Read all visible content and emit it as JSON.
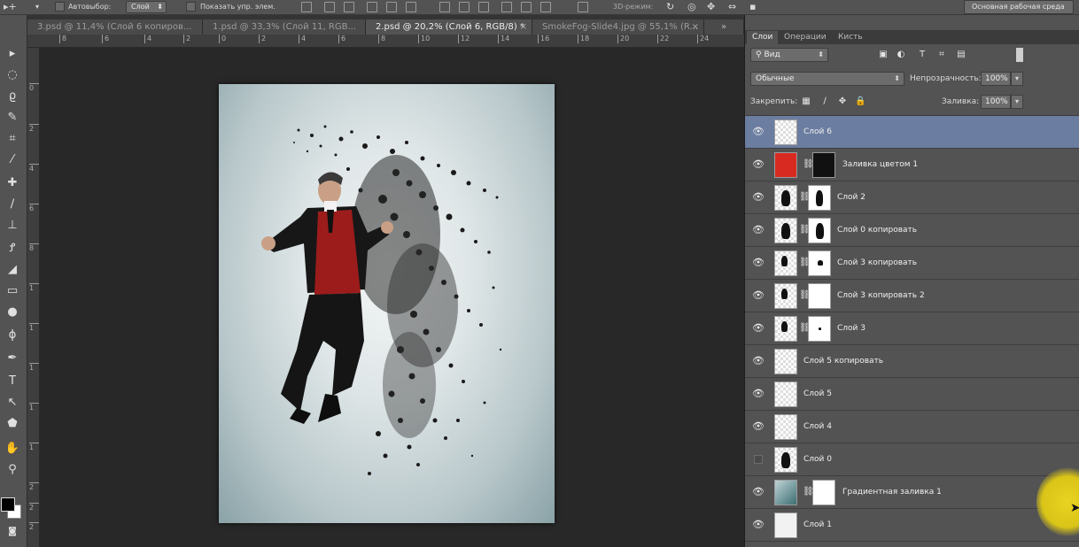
{
  "option_bar": {
    "auto_select_label": "Автовыбор:",
    "auto_select_value": "Слой",
    "show_transform_label": "Показать упр. элем.",
    "mode_3d_label": "3D-режим:",
    "workspace_label": "Основная рабочая среда"
  },
  "tabs": [
    {
      "label": "3.psd @ 11,4% (Слой 6 копиров...",
      "active": false
    },
    {
      "label": "1.psd @ 33,3% (Слой 11, RGB...",
      "active": false
    },
    {
      "label": "2.psd @ 20,2% (Слой 6, RGB/8) *",
      "active": true
    },
    {
      "label": "SmokeFog-Slide4.jpg @ 55,1% (R...",
      "active": false
    }
  ],
  "ruler_top": [
    "8",
    "6",
    "4",
    "2",
    "0",
    "2",
    "4",
    "6",
    "8",
    "10",
    "12",
    "14",
    "16",
    "18",
    "20",
    "22",
    "24"
  ],
  "ruler_left": [
    "0",
    "2",
    "4",
    "6",
    "8",
    "1",
    "1",
    "1",
    "1",
    "1",
    "2",
    "2",
    "2"
  ],
  "panel": {
    "tabs": [
      "Слои",
      "Операции",
      "Кисть"
    ],
    "filter_label": "Вид",
    "blend_mode": "Обычные",
    "opacity_label": "Непрозрачность:",
    "opacity_value": "100%",
    "lock_label": "Закрепить:",
    "fill_label": "Заливка:",
    "fill_value": "100%"
  },
  "layers": [
    {
      "name": "Слой 6",
      "selected": true,
      "visible": true
    },
    {
      "name": "Заливка цветом 1",
      "selected": false,
      "visible": true
    },
    {
      "name": "Слой 2",
      "selected": false,
      "visible": true
    },
    {
      "name": "Слой 0 копировать",
      "selected": false,
      "visible": true
    },
    {
      "name": "Слой 3 копировать",
      "selected": false,
      "visible": true
    },
    {
      "name": "Слой 3 копировать 2",
      "selected": false,
      "visible": true
    },
    {
      "name": "Слой 3",
      "selected": false,
      "visible": true
    },
    {
      "name": "Слой 5 копировать",
      "selected": false,
      "visible": true
    },
    {
      "name": "Слой 5",
      "selected": false,
      "visible": true
    },
    {
      "name": "Слой 4",
      "selected": false,
      "visible": true
    },
    {
      "name": "Слой 0",
      "selected": false,
      "visible": false
    },
    {
      "name": "Градиентная заливка 1",
      "selected": false,
      "visible": true
    },
    {
      "name": "Слой 1",
      "selected": false,
      "visible": true
    }
  ],
  "colors": {
    "panel_bg": "#535353",
    "canvas_bg": "#282828",
    "selected_layer": "#6b7da0",
    "fill_layer_red": "#d92a22",
    "cursor_highlight": "#e9d321"
  }
}
